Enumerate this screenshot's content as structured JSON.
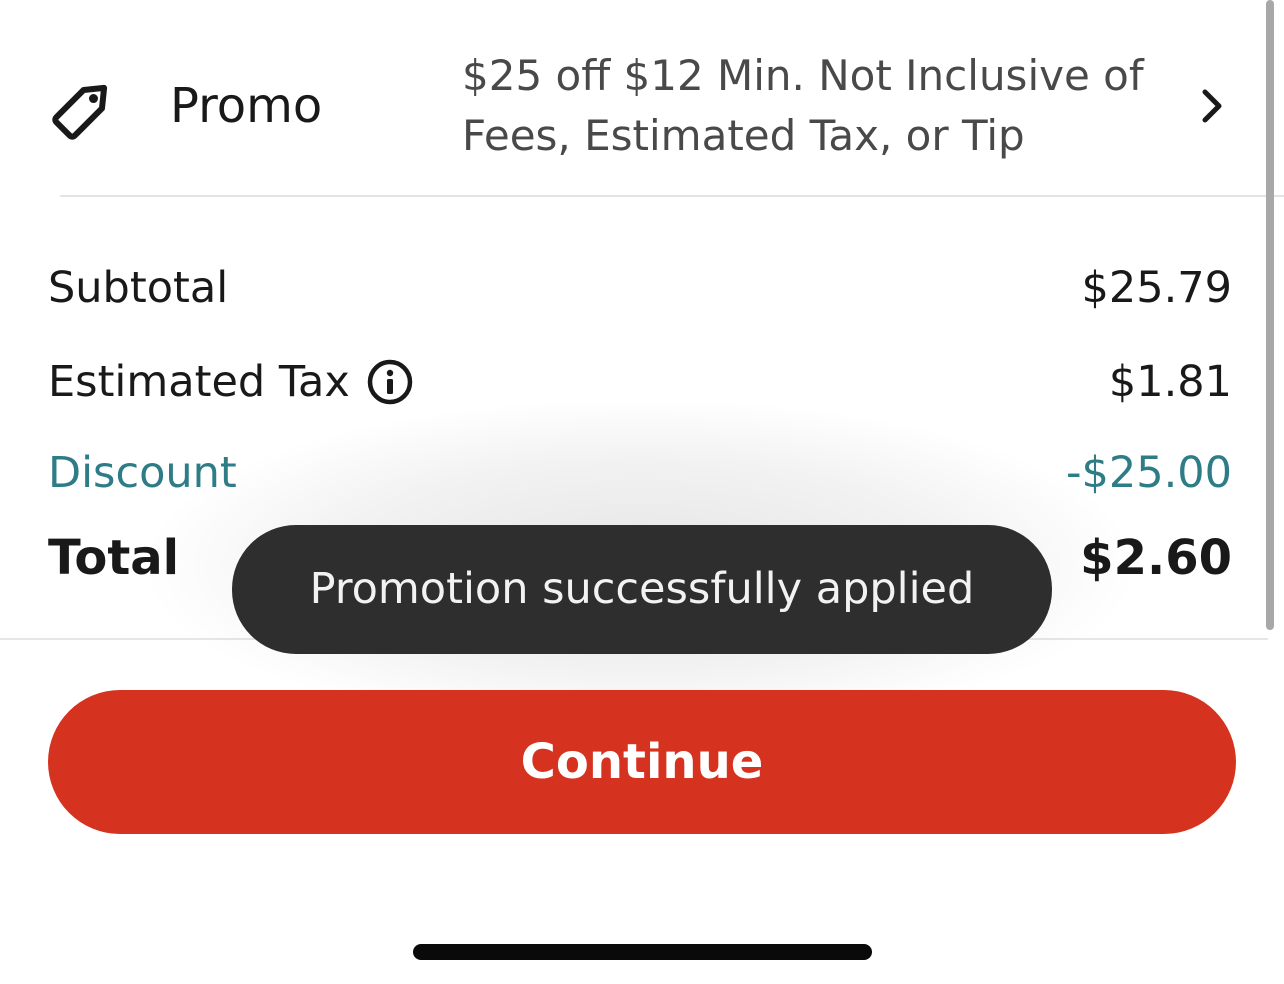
{
  "promo": {
    "label": "Promo",
    "icon": "tag-icon",
    "description_line1": "$25 off $12 Min. Not Inclusive of",
    "description_line2": "Fees, Estimated Tax, or Tip",
    "chevron_icon": "chevron-right-icon"
  },
  "summary": {
    "subtotal": {
      "label": "Subtotal",
      "value": "$25.79"
    },
    "tax": {
      "label": "Estimated Tax",
      "value": "$1.81",
      "info_icon": "info-icon"
    },
    "discount": {
      "label": "Discount",
      "value": "-$25.00",
      "color": "#2e7d86"
    },
    "total": {
      "label": "Total",
      "value": "$2.60"
    }
  },
  "toast": {
    "message": "Promotion successfully applied"
  },
  "continue_button": {
    "label": "Continue",
    "color": "#d5321f"
  }
}
